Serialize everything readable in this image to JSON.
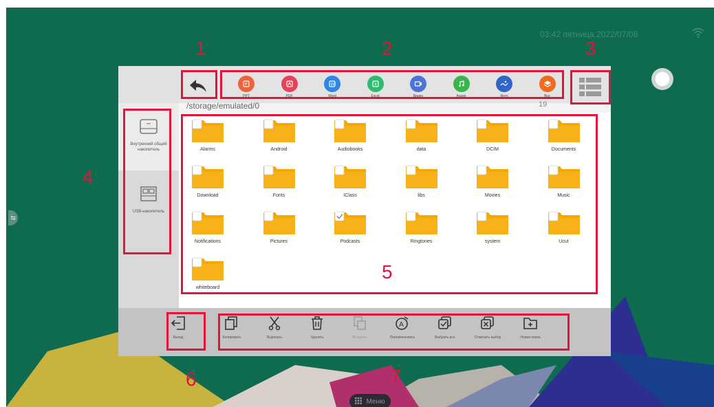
{
  "status": {
    "clock": "03:42 пятница.2022/07/08"
  },
  "dock": {
    "menu_label": "Меню"
  },
  "file_manager": {
    "path": "/storage/emulated/0",
    "count": "19",
    "categories": [
      {
        "label": "PPT",
        "icon": "ppt-icon",
        "color": "#f0623a"
      },
      {
        "label": "PDF",
        "icon": "pdf-icon",
        "color": "#e8415a"
      },
      {
        "label": "Word",
        "icon": "word-icon",
        "color": "#2f86e5"
      },
      {
        "label": "Excel",
        "icon": "excel-icon",
        "color": "#2dbb6e"
      },
      {
        "label": "Видео",
        "icon": "video-icon",
        "color": "#4d73d9"
      },
      {
        "label": "Аудио",
        "icon": "audio-icon",
        "color": "#39b54a"
      },
      {
        "label": "Фото",
        "icon": "photo-icon",
        "color": "#2f66c8"
      },
      {
        "label": "Все",
        "icon": "all-layers-icon",
        "color": "#ef6a1f"
      }
    ],
    "sidebar": [
      {
        "label_line1": "Внутренний общий",
        "label_line2": "накопитель",
        "icon": "internal-storage-icon"
      },
      {
        "label_line1": "USB-накопитель",
        "label_line2": "",
        "icon": "usb-drive-icon"
      }
    ],
    "folders": [
      {
        "name": "Alarms",
        "checked": false
      },
      {
        "name": "Android",
        "checked": false
      },
      {
        "name": "Audiobooks",
        "checked": false
      },
      {
        "name": "data",
        "checked": false
      },
      {
        "name": "DCIM",
        "checked": false
      },
      {
        "name": "Documents",
        "checked": false
      },
      {
        "name": "Download",
        "checked": false
      },
      {
        "name": "Fonts",
        "checked": false
      },
      {
        "name": "IClass",
        "checked": false
      },
      {
        "name": "libs",
        "checked": false
      },
      {
        "name": "Movies",
        "checked": false
      },
      {
        "name": "Music",
        "checked": false
      },
      {
        "name": "Notifications",
        "checked": false
      },
      {
        "name": "Pictures",
        "checked": false
      },
      {
        "name": "Podcasts",
        "checked": true
      },
      {
        "name": "Ringtones",
        "checked": false
      },
      {
        "name": "system",
        "checked": false
      },
      {
        "name": "Ucut",
        "checked": false
      },
      {
        "name": "whiteboard",
        "checked": false
      }
    ],
    "exit_label": "Выход",
    "actions": [
      {
        "label": "Копировать",
        "icon": "copy-icon",
        "disabled": false
      },
      {
        "label": "Вырезать",
        "icon": "cut-icon",
        "disabled": false
      },
      {
        "label": "Удалить",
        "icon": "delete-icon",
        "disabled": false
      },
      {
        "label": "Вставить",
        "icon": "paste-icon",
        "disabled": true
      },
      {
        "label": "Переименовать",
        "icon": "rename-icon",
        "disabled": false
      },
      {
        "label": "Выбрать все",
        "icon": "select-all-icon",
        "disabled": false
      },
      {
        "label": "Отменить выбор",
        "icon": "deselect-icon",
        "disabled": false
      },
      {
        "label": "Новая папка",
        "icon": "new-folder-icon",
        "disabled": false
      }
    ]
  },
  "annotations": [
    "1",
    "2",
    "3",
    "4",
    "5",
    "6",
    "7"
  ],
  "colors": {
    "accent": "#e0143c",
    "folder": "#f5a800",
    "desktop": "#0f6b4f"
  }
}
